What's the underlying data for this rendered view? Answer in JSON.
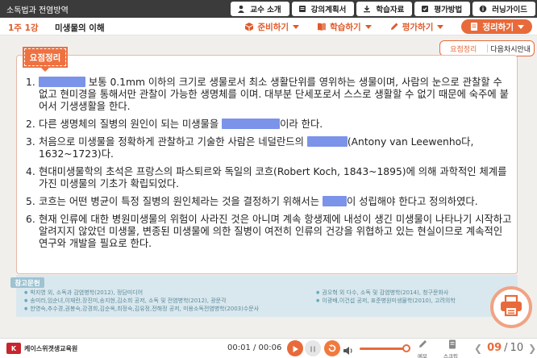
{
  "header": {
    "course": "소독법과 전염방역",
    "nav": [
      {
        "label": "교수 소개",
        "icon": "professor-icon"
      },
      {
        "label": "강의계획서",
        "icon": "syllabus-icon"
      },
      {
        "label": "학습자료",
        "icon": "download-icon"
      },
      {
        "label": "평가방법",
        "icon": "grade-icon"
      },
      {
        "label": "러닝가이드",
        "icon": "info-icon"
      }
    ]
  },
  "lesson": {
    "week": "1주 1강",
    "title": "미생물의 이해",
    "tabs": [
      {
        "label": "준비하기",
        "icon": "cube-icon"
      },
      {
        "label": "학습하기",
        "icon": "book-icon"
      },
      {
        "label": "평가하기",
        "icon": "pencil-icon"
      },
      {
        "label": "정리하기",
        "icon": "notebook-icon"
      }
    ],
    "active_tab": "정리하기",
    "dropdown": [
      "요점정리",
      "다음차시안내"
    ]
  },
  "summary": {
    "tag": "요점정리",
    "items": [
      {
        "num": "1.",
        "before": "",
        "after": " 보통 0.1mm 이하의 크기로 생물로서 최소 생활단위를 영위하는 생물이며, 사람의 눈으로 관찰할 수 없고 현미경을 통해서만 관찰이 가능한 생명체를 이며. 대부분 단세포로서 스스로 생활할 수 없기 때문에 숙주에 붙어서 기생생활을 한다."
      },
      {
        "num": "2.",
        "before": "다른 생명체의 질병의 원인이 되는 미생물을 ",
        "after": "이라 한다."
      },
      {
        "num": "3.",
        "before": "처음으로 미생물을 정확하게 관찰하고 기술한 사람은 네덜란드의 ",
        "after": "(Antony van Leewenho다, 1632~1723)다."
      },
      {
        "num": "4.",
        "before": "현대미생물학의 초석은 프랑스의 파스퇴르와 독일의 코흐(Robert Koch, 1843~1895)에 의해 과학적인 체계를 가진 미생물의 기초가 확립되었다.",
        "after": ""
      },
      {
        "num": "5.",
        "before": "코흐는 어떤 병균이 특정 질병의 원인체라는 것을 결정하기 위해서는 ",
        "after": "이 성립해야 한다고 정의하였다."
      },
      {
        "num": "6.",
        "before": "현재 인류에 대한 병원미생물의 위험이 사라진 것은 아니며 계속 항생제에 내성이 생긴 미생물이 나타나기 시작하고 알려지지 않았던 미생물, 변종된 미생물에 의한 질병이 여전히 인류의 건강을 위협하고 있는 현실이므로 계속적인 연구와 개발을 필요로 한다.",
        "after": ""
      }
    ]
  },
  "references": {
    "title": "참고문헌",
    "left": [
      "박지영 외, 소독과 감염병학(2012), 정담미디어",
      "송미라,임순녀,이재란,장진미,송지현,김소희 공저, 소독 및 전염병학(2012), 광문각",
      "한영숙,추수경,권봉숙,강경희,김순옥,최정숙,김유정,전해정 공저, 미용소독전염병학(2003)수문사"
    ],
    "right": [
      "권오혁 외 다수, 소독 및 감염병학(2014), 청구문화사",
      "이광배,이건섭 공저, 표준병원미생물학(2010), 고려의학"
    ]
  },
  "player": {
    "brand": "케이스위겟생교육원",
    "time": "00:01 / 00:06",
    "volume": 0.9,
    "memo_label": "메모",
    "script_label": "스크립트",
    "page_current": "09",
    "page_separator": "/",
    "page_total": "10"
  },
  "colors": {
    "accent": "#e86a3a",
    "blank": "#7b93e8",
    "topbar": "#3b3b3b"
  }
}
